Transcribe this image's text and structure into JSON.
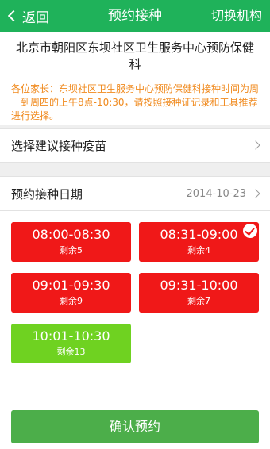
{
  "header": {
    "back_label": "返回",
    "title": "预约接种",
    "switch_label": "切换机构"
  },
  "org": {
    "name": "北京市朝阳区东坝社区卫生服务中心预防保健科"
  },
  "notice": {
    "text": "各位家长：东坝社区卫生服务中心预防保健科接种时间为周一到周四的上午8点-10:30，请按照接种证记录和工具推荐进行选择。"
  },
  "vaccine_row": {
    "label": "选择建议接种疫苗"
  },
  "date_row": {
    "label": "预约接种日期",
    "value": "2014-10-23"
  },
  "slots": [
    {
      "time": "08:00-08:30",
      "remaining": "剩余5",
      "color": "#f01818",
      "selected": false
    },
    {
      "time": "08:31-09:00",
      "remaining": "剩余4",
      "color": "#f01818",
      "selected": true
    },
    {
      "time": "09:01-09:30",
      "remaining": "剩余9",
      "color": "#f01818",
      "selected": false
    },
    {
      "time": "09:31-10:00",
      "remaining": "剩余7",
      "color": "#f01818",
      "selected": false
    },
    {
      "time": "10:01-10:30",
      "remaining": "剩余13",
      "color": "#6fd221",
      "selected": false
    }
  ],
  "confirm": {
    "label": "确认预约"
  },
  "colors": {
    "header": "#1fb25a",
    "notice_text": "#f08a1e",
    "confirm": "#4cae4a"
  }
}
